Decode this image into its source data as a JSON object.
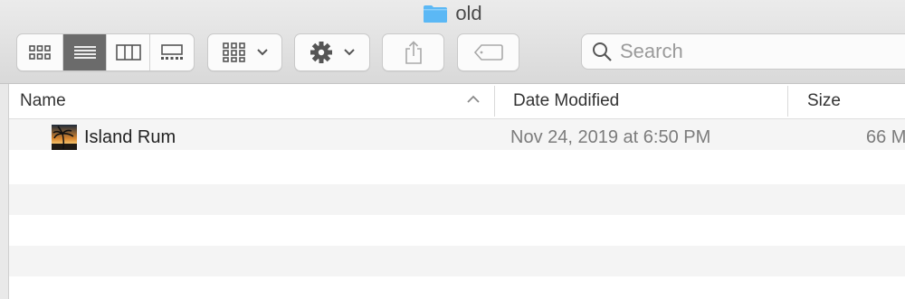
{
  "window": {
    "title": "old"
  },
  "toolbar": {
    "view_modes": [
      "icon-view-icon",
      "list-view-icon",
      "column-view-icon",
      "gallery-view-icon"
    ],
    "active_view": "list",
    "group_icon": "grid-group-icon",
    "action_icon": "gear-icon",
    "share_icon": "share-icon",
    "tag_icon": "tag-icon",
    "search": {
      "placeholder": "Search",
      "value": ""
    }
  },
  "columns": {
    "name": "Name",
    "date": "Date Modified",
    "size": "Size"
  },
  "files": [
    {
      "name": "Island Rum",
      "date": "Nov 24, 2019 at 6:50 PM",
      "size": "66 M"
    }
  ],
  "colors": {
    "active_segment": "#6b6b6b",
    "folder": "#5bb8f5"
  }
}
